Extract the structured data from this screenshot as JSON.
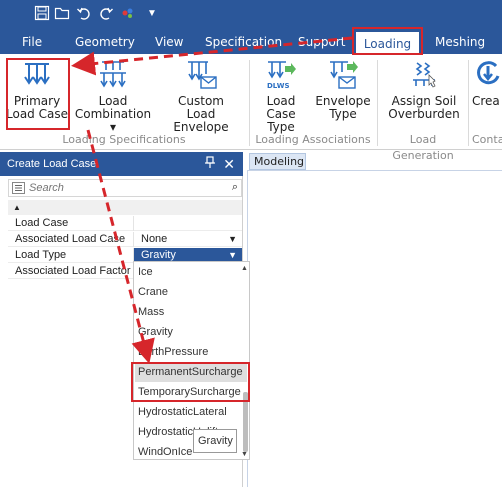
{
  "quick_access": {
    "icons": [
      "save-icon",
      "open-folder-icon",
      "undo-icon",
      "redo-icon",
      "color-picker-icon",
      "dropdown-arrow-icon"
    ]
  },
  "menubar": {
    "tabs": [
      {
        "label": "File"
      },
      {
        "label": "Geometry"
      },
      {
        "label": "View"
      },
      {
        "label": "Specification"
      },
      {
        "label": "Support"
      },
      {
        "label": "Loading"
      },
      {
        "label": "Meshing"
      }
    ],
    "active": "Loading"
  },
  "ribbon": {
    "buttons": [
      {
        "label1": "Primary",
        "label2": "Load Case",
        "icon": "primary-load-case-icon"
      },
      {
        "label1": "Load",
        "label2": "Combination ▾",
        "icon": "load-combination-icon"
      },
      {
        "label1": "Custom",
        "label2": "Load Envelope",
        "icon": "custom-load-envelope-icon"
      },
      {
        "label1": "Load",
        "label2": "Case Type",
        "icon": "load-case-type-icon",
        "badge": "DLWS"
      },
      {
        "label1": "Envelope",
        "label2": "Type",
        "icon": "envelope-type-icon"
      },
      {
        "label1": "Assign Soil",
        "label2": "Overburden",
        "icon": "assign-soil-overburden-icon"
      },
      {
        "label1": "Crea",
        "label2": "",
        "icon": "create-icon"
      }
    ],
    "groups": [
      {
        "label": "Loading Specifications"
      },
      {
        "label": "Loading Associations"
      },
      {
        "label": "Load Generation"
      },
      {
        "label": "Conta"
      }
    ]
  },
  "panel": {
    "title": "Create Load Case",
    "pin_icon": "pin-icon",
    "close_icon": "close-icon",
    "search_placeholder": "Search",
    "properties": [
      {
        "name": "Load Case",
        "value": ""
      },
      {
        "name": "Associated Load Case",
        "value": "None"
      },
      {
        "name": "Load Type",
        "value": "Gravity"
      },
      {
        "name": "Associated Load Factor",
        "value": ""
      }
    ]
  },
  "dropdown": {
    "items": [
      "Ice",
      "Crane",
      "Mass",
      "Gravity",
      "EarthPressure",
      "PermanentSurcharge",
      "TemporarySurcharge",
      "HydrostaticLateral",
      "HydrostaticUplift",
      "WindOnIce"
    ],
    "highlighted": "PermanentSurcharge"
  },
  "tooltip": {
    "text": "Gravity"
  },
  "workspace": {
    "tab": "Modeling"
  },
  "colors": {
    "brand": "#2b579a",
    "annotation": "#d6262b",
    "selection": "#2b579a"
  }
}
